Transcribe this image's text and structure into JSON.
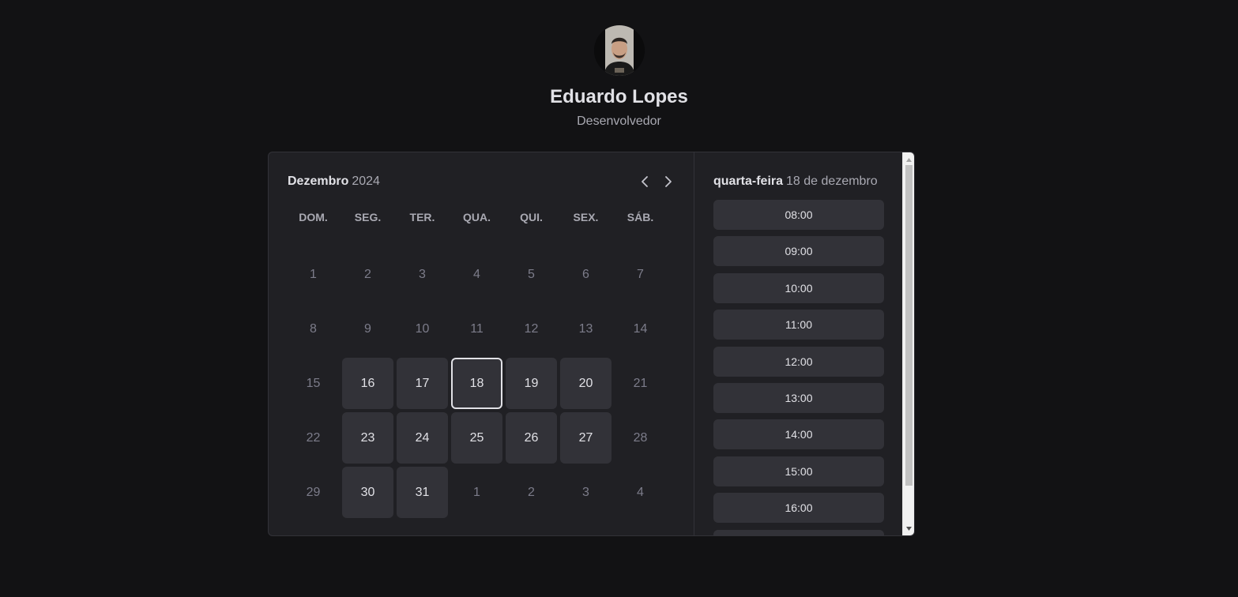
{
  "profile": {
    "name": "Eduardo Lopes",
    "role": "Desenvolvedor"
  },
  "calendar": {
    "month": "Dezembro",
    "year": "2024",
    "weekdays": [
      "DOM.",
      "SEG.",
      "TER.",
      "QUA.",
      "QUI.",
      "SEX.",
      "SÁB."
    ],
    "weeks": [
      [
        {
          "d": "1",
          "s": "disabled"
        },
        {
          "d": "2",
          "s": "disabled"
        },
        {
          "d": "3",
          "s": "disabled"
        },
        {
          "d": "4",
          "s": "disabled"
        },
        {
          "d": "5",
          "s": "disabled"
        },
        {
          "d": "6",
          "s": "disabled"
        },
        {
          "d": "7",
          "s": "disabled"
        }
      ],
      [
        {
          "d": "8",
          "s": "disabled"
        },
        {
          "d": "9",
          "s": "disabled"
        },
        {
          "d": "10",
          "s": "disabled"
        },
        {
          "d": "11",
          "s": "disabled"
        },
        {
          "d": "12",
          "s": "disabled"
        },
        {
          "d": "13",
          "s": "disabled"
        },
        {
          "d": "14",
          "s": "disabled"
        }
      ],
      [
        {
          "d": "15",
          "s": "disabled"
        },
        {
          "d": "16",
          "s": "available"
        },
        {
          "d": "17",
          "s": "available"
        },
        {
          "d": "18",
          "s": "selected"
        },
        {
          "d": "19",
          "s": "available"
        },
        {
          "d": "20",
          "s": "available"
        },
        {
          "d": "21",
          "s": "disabled"
        }
      ],
      [
        {
          "d": "22",
          "s": "disabled"
        },
        {
          "d": "23",
          "s": "available"
        },
        {
          "d": "24",
          "s": "available"
        },
        {
          "d": "25",
          "s": "available"
        },
        {
          "d": "26",
          "s": "available"
        },
        {
          "d": "27",
          "s": "available"
        },
        {
          "d": "28",
          "s": "disabled"
        }
      ],
      [
        {
          "d": "29",
          "s": "disabled"
        },
        {
          "d": "30",
          "s": "available"
        },
        {
          "d": "31",
          "s": "available"
        },
        {
          "d": "1",
          "s": "disabled"
        },
        {
          "d": "2",
          "s": "disabled"
        },
        {
          "d": "3",
          "s": "disabled"
        },
        {
          "d": "4",
          "s": "disabled"
        }
      ]
    ]
  },
  "time_picker": {
    "weekday": "quarta-feira",
    "date": "18 de dezembro",
    "times": [
      "08:00",
      "09:00",
      "10:00",
      "11:00",
      "12:00",
      "13:00",
      "14:00",
      "15:00",
      "16:00",
      ""
    ]
  },
  "icons": {
    "prev": "caret-left-icon",
    "next": "caret-right-icon"
  },
  "colors": {
    "background": "#121214",
    "card": "#202024",
    "day_available": "#323238",
    "text": "#e1e1e6",
    "muted": "#7c7c8a"
  }
}
